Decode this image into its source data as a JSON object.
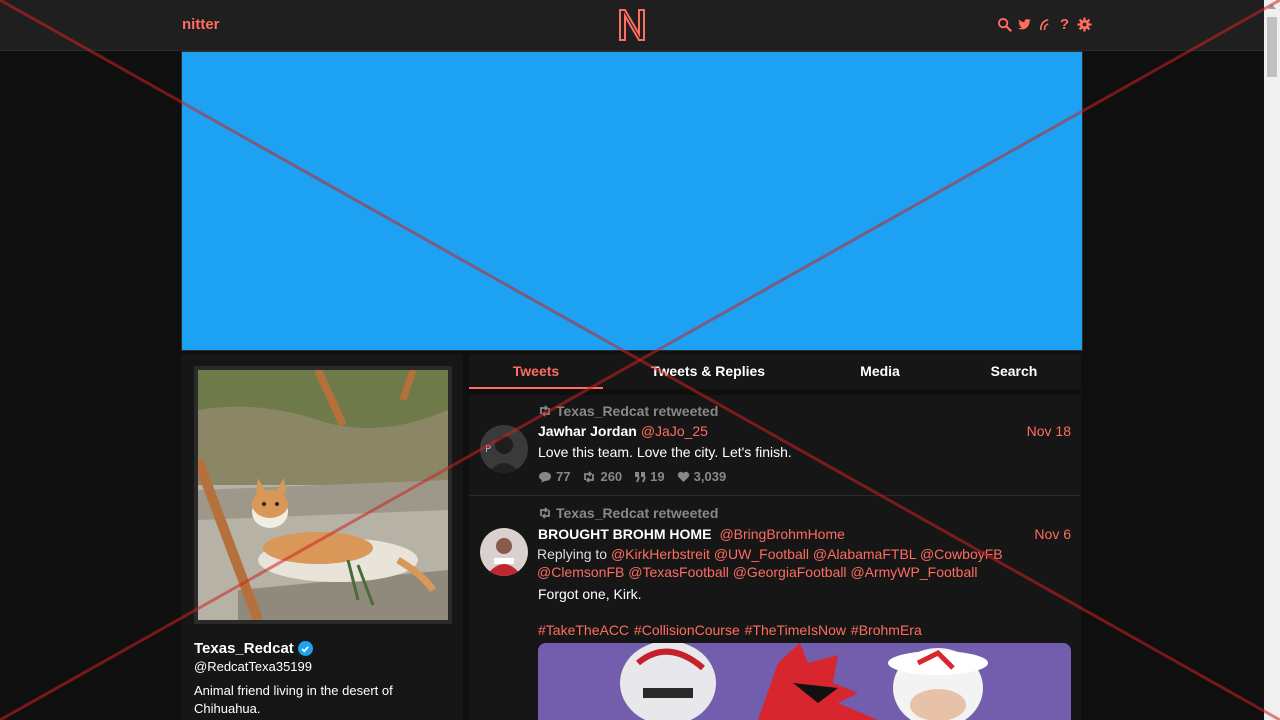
{
  "nav": {
    "brand": "nitter"
  },
  "tabs": [
    "Tweets",
    "Tweets & Replies",
    "Media",
    "Search"
  ],
  "profile": {
    "name": "Texas_Redcat",
    "handle": "@RedcatTexa35199",
    "bio": "Animal friend living in the desert of Chihuahua."
  },
  "tweets": [
    {
      "retweet_header": "Texas_Redcat retweeted",
      "name": "Jawhar Jordan",
      "handle": "@JaJo_25",
      "date": "Nov 18",
      "text": "Love this team. Love the city. Let's finish.",
      "replies": "77",
      "retweets": "260",
      "quotes": "19",
      "likes": "3,039"
    },
    {
      "retweet_header": "Texas_Redcat retweeted",
      "name": "BROUGHT BROHM HOME",
      "handle": "@BringBrohmHome",
      "date": "Nov 6",
      "replying_label": "Replying to",
      "mentions": [
        "@KirkHerbstreit",
        "@UW_Football",
        "@AlabamaFTBL",
        "@CowboyFB",
        "@ClemsonFB",
        "@TexasFootball",
        "@GeorgiaFootball",
        "@ArmyWP_Football"
      ],
      "text": "Forgot one, Kirk.",
      "hashtags": "#TakeTheACC #CollisionCourse #TheTimeIsNow  #BrohmEra"
    }
  ],
  "colors": {
    "accent": "#ff6c60",
    "banner": "#1da1f2",
    "background": "#0f0f0f",
    "panel": "#161616"
  },
  "icons": [
    "search-icon",
    "twitter-bird-icon",
    "rss-icon",
    "help-icon",
    "settings-icon",
    "retweet-icon",
    "comment-icon",
    "quote-icon",
    "heart-icon",
    "verified-icon"
  ]
}
